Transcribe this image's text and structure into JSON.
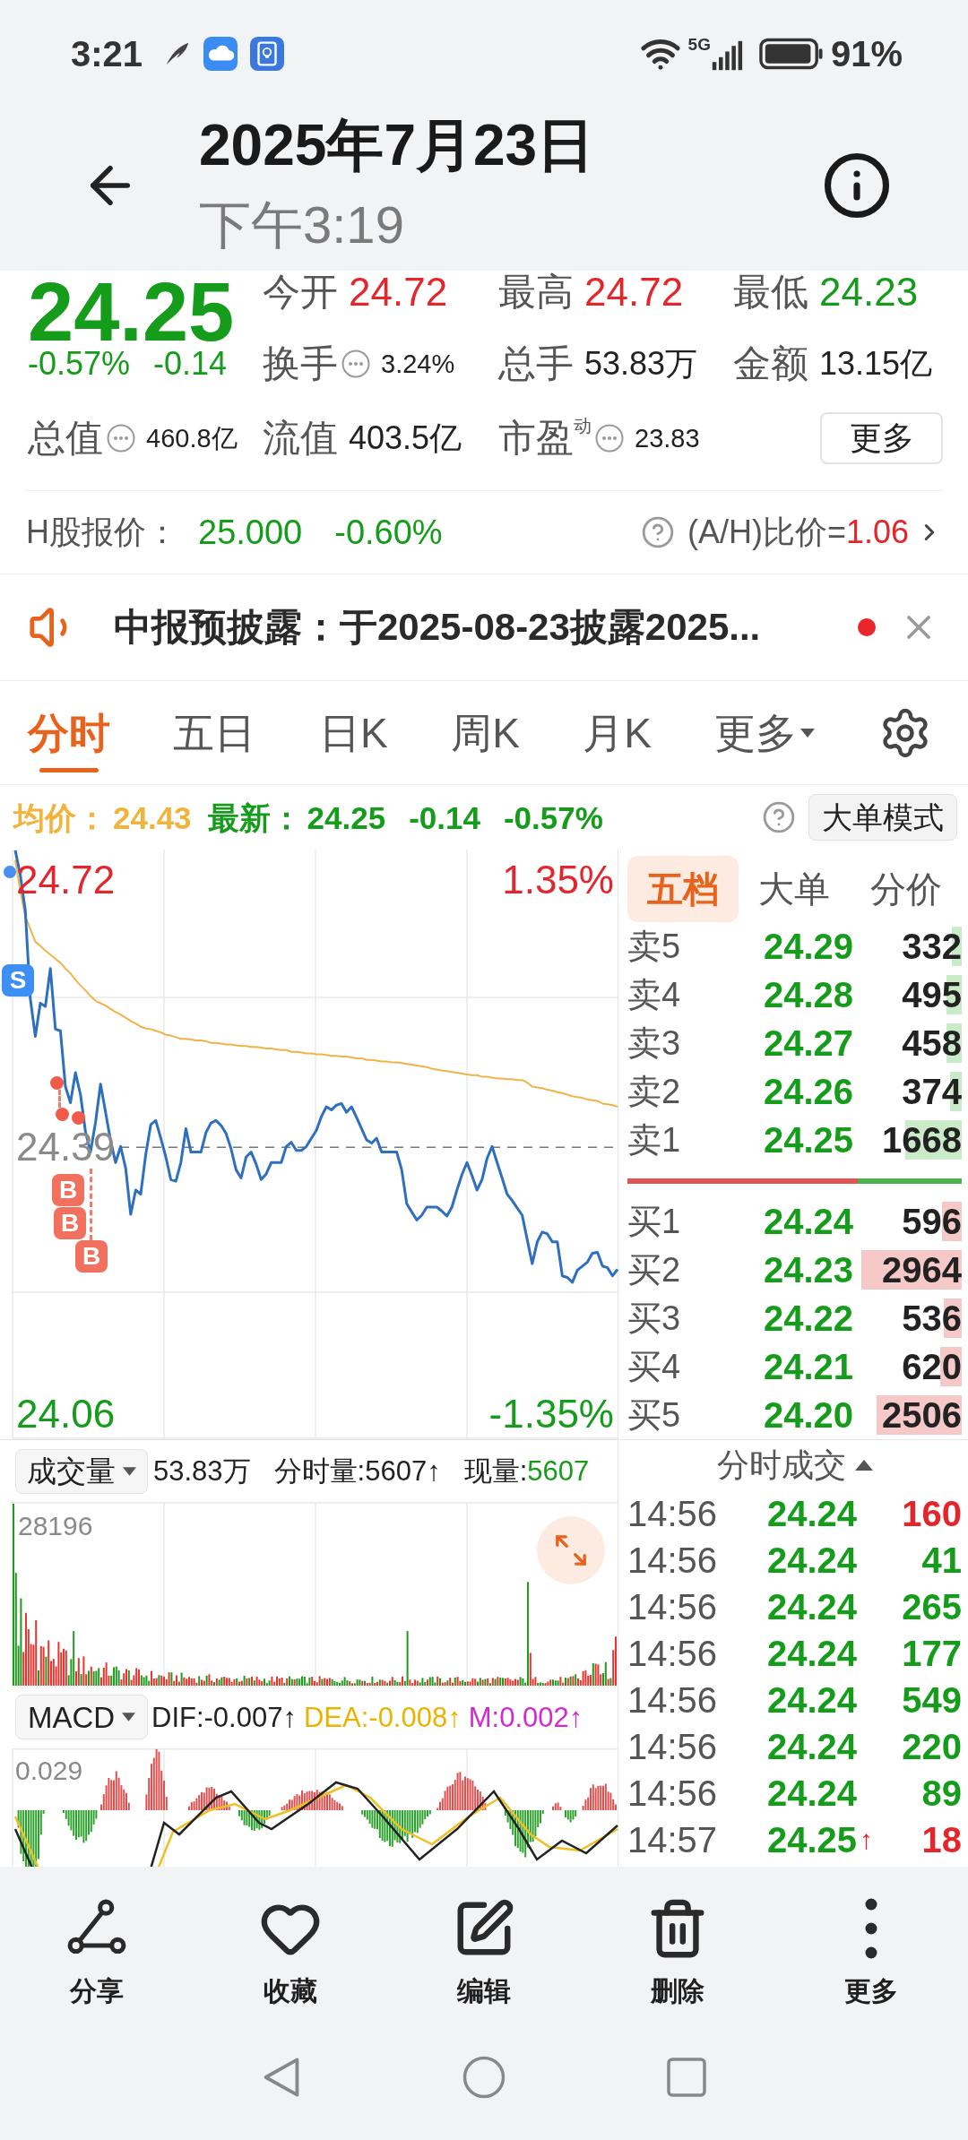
{
  "status_bar": {
    "time": "3:21",
    "network": "5G",
    "battery": "91%"
  },
  "header": {
    "title": "2025年7月23日",
    "subtitle": "下午3:19"
  },
  "quote": {
    "price": "24.25",
    "color": "#169c1b",
    "change_pct": "-0.57%",
    "change": "-0.14",
    "stats": [
      [
        {
          "label": "今开",
          "info": false,
          "value": "24.72",
          "color": "#e3262c"
        },
        {
          "label": "最高",
          "info": false,
          "value": "24.72",
          "color": "#e3262c"
        },
        {
          "label": "最低",
          "info": false,
          "value": "24.23",
          "color": "#169c1b"
        }
      ],
      [
        {
          "label": "换手",
          "info": true,
          "value": "3.24%",
          "color": "#222222"
        },
        {
          "label": "总手",
          "info": false,
          "value": "53.83万",
          "color": "#222222"
        },
        {
          "label": "金额",
          "info": false,
          "value": "13.15亿",
          "color": "#222222"
        }
      ],
      [
        {
          "label": "总值",
          "info": true,
          "value": "460.8亿",
          "color": "#222222"
        },
        {
          "label": "流值",
          "info": false,
          "value": "403.5亿",
          "color": "#222222"
        },
        {
          "label": "市盈",
          "superscript": "动",
          "info": true,
          "value": "23.83",
          "color": "#222222"
        }
      ]
    ],
    "more_button": "更多"
  },
  "h_share": {
    "label": "H股报价：",
    "price": "25.000",
    "change": "-0.60%",
    "color": "#169c1b",
    "ratio_label": "(A/H)比价=",
    "ratio": {
      "text": "1.06",
      "color": "#e3262c"
    }
  },
  "notice": {
    "text": "中报预披露：于2025-08-23披露2025...",
    "unread": true
  },
  "chart_tabs": [
    {
      "label": "分时",
      "selected": true,
      "dropdown": false
    },
    {
      "label": "五日",
      "selected": false,
      "dropdown": false
    },
    {
      "label": "日K",
      "selected": false,
      "dropdown": false
    },
    {
      "label": "周K",
      "selected": false,
      "dropdown": false
    },
    {
      "label": "月K",
      "selected": false,
      "dropdown": false
    },
    {
      "label": "更多",
      "selected": false,
      "dropdown": true
    }
  ],
  "summary": {
    "avg_label": "均价：",
    "avg": "24.43",
    "latest_label": "最新：",
    "latest": "24.25",
    "change": "-0.14",
    "change_pct": "-0.57%",
    "color": "#169c1b",
    "mode_button": "大单模式"
  },
  "price_chart": {
    "chart_data": {
      "type": "line",
      "categories": [
        null,
        null,
        null,
        null,
        null,
        null,
        null,
        null,
        null,
        null,
        null,
        null,
        null,
        null,
        null,
        null,
        null,
        null,
        null,
        null,
        null,
        null,
        null,
        null,
        null,
        null,
        null,
        null,
        null,
        null,
        null,
        null,
        null,
        null,
        null,
        null,
        null,
        null,
        null,
        null,
        null,
        null,
        null,
        null,
        null,
        null,
        null,
        null,
        null,
        null,
        null,
        null,
        null,
        null,
        null,
        null,
        null,
        null,
        null,
        null,
        null,
        null,
        null,
        null,
        null,
        null,
        null,
        null,
        null,
        null,
        null,
        null,
        null,
        null,
        null,
        null,
        null,
        null,
        null,
        null,
        null,
        null,
        null,
        null,
        null,
        null,
        null,
        null,
        null,
        null,
        null,
        null,
        null,
        null,
        null,
        null,
        null,
        null,
        null,
        null,
        null,
        null,
        null,
        null,
        null,
        null,
        null,
        null,
        null,
        null,
        null,
        null,
        null,
        null,
        null,
        null,
        null,
        null,
        null,
        null,
        null
      ],
      "series": [
        {
          "color": "#f0b44a",
          "values": [
            24.745,
            24.707,
            24.675,
            24.66,
            24.644,
            24.639,
            24.633,
            24.628,
            24.623,
            24.618,
            24.611,
            24.605,
            24.597,
            24.59,
            24.584,
            24.577,
            24.571,
            24.568,
            24.565,
            24.561,
            24.557,
            24.554,
            24.55,
            24.546,
            24.543,
            24.539,
            24.537,
            24.536,
            24.534,
            24.532,
            24.529,
            24.528,
            24.526,
            24.524,
            24.524,
            24.523,
            24.522,
            24.522,
            24.521,
            24.519,
            24.519,
            24.518,
            24.517,
            24.517,
            24.516,
            24.515,
            24.515,
            24.514,
            24.514,
            24.513,
            24.512,
            24.512,
            24.511,
            24.51,
            24.51,
            24.508,
            24.508,
            24.507,
            24.506,
            24.506,
            24.505,
            24.505,
            24.504,
            24.503,
            24.503,
            24.502,
            24.502,
            24.501,
            24.5,
            24.5,
            24.498,
            24.498,
            24.497,
            24.496,
            24.496,
            24.495,
            24.495,
            24.494,
            24.493,
            24.492,
            24.491,
            24.49,
            24.489,
            24.487,
            24.486,
            24.485,
            24.484,
            24.483,
            24.482,
            24.481,
            24.48,
            24.479,
            24.479,
            24.477,
            24.477,
            24.476,
            24.475,
            24.475,
            24.474,
            24.474,
            24.473,
            24.473,
            24.47,
            24.465,
            24.464,
            24.463,
            24.461,
            24.46,
            24.458,
            24.457,
            24.455,
            24.453,
            24.452,
            24.451,
            24.449,
            24.448,
            24.447,
            24.444,
            24.443,
            24.442,
            24.44
          ]
        },
        {
          "color": "#2f6fbf",
          "values": [
            24.757,
            24.727,
            24.683,
            24.574,
            24.527,
            24.568,
            24.564,
            24.611,
            24.536,
            24.534,
            24.465,
            24.445,
            24.482,
            24.455,
            24.409,
            24.384,
            24.421,
            24.468,
            24.433,
            24.398,
            24.371,
            24.391,
            24.364,
            24.307,
            24.337,
            24.332,
            24.381,
            24.418,
            24.423,
            24.401,
            24.378,
            24.35,
            24.348,
            24.371,
            24.413,
            24.384,
            24.384,
            24.384,
            24.408,
            24.42,
            24.423,
            24.417,
            24.407,
            24.388,
            24.362,
            24.352,
            24.378,
            24.384,
            24.369,
            24.35,
            24.357,
            24.371,
            24.371,
            24.371,
            24.391,
            24.396,
            24.386,
            24.386,
            24.391,
            24.401,
            24.411,
            24.428,
            24.44,
            24.436,
            24.442,
            24.444,
            24.433,
            24.44,
            24.427,
            24.413,
            24.399,
            24.395,
            24.401,
            24.384,
            24.384,
            24.384,
            24.384,
            24.362,
            24.32,
            24.31,
            24.3,
            24.306,
            24.316,
            24.316,
            24.316,
            24.311,
            24.305,
            24.316,
            24.337,
            24.356,
            24.371,
            24.355,
            24.337,
            24.35,
            24.376,
            24.391,
            24.371,
            24.352,
            24.332,
            24.324,
            24.315,
            24.306,
            24.276,
            24.246,
            24.273,
            24.285,
            24.283,
            24.273,
            24.273,
            24.231,
            24.229,
            24.223,
            24.238,
            24.243,
            24.248,
            24.259,
            24.26,
            24.243,
            24.241,
            24.231,
            24.239
          ]
        }
      ],
      "ylim": [
        24.029,
        24.758
      ],
      "yticks": [
        {
          "value": 24.06,
          "label": "24.06"
        },
        {
          "value": 24.39,
          "label": "24.39"
        },
        {
          "value": 24.72,
          "label": "24.72"
        }
      ],
      "ref_lines": [
        {
          "axis": "y",
          "value": 24.39
        }
      ]
    },
    "high_pct": "1.35%",
    "low_pct": "-1.35%",
    "markers": [
      {
        "kind": "sell",
        "label": "S"
      },
      {
        "kind": "buy",
        "label": "B"
      },
      {
        "kind": "buy",
        "label": "B"
      },
      {
        "kind": "buy",
        "label": "B"
      }
    ]
  },
  "order_book": {
    "tabs": [
      {
        "label": "五档",
        "selected": true
      },
      {
        "label": "大单",
        "selected": false
      },
      {
        "label": "分价",
        "selected": false
      }
    ],
    "asks": [
      {
        "label": "卖5",
        "price": "24.29",
        "volume": "332",
        "color": "#169c1b",
        "level": 0.1
      },
      {
        "label": "卖4",
        "price": "24.28",
        "volume": "495",
        "color": "#169c1b",
        "level": 0.15
      },
      {
        "label": "卖3",
        "price": "24.27",
        "volume": "458",
        "color": "#169c1b",
        "level": 0.15
      },
      {
        "label": "卖2",
        "price": "24.26",
        "volume": "374",
        "color": "#169c1b",
        "level": 0.12
      },
      {
        "label": "卖1",
        "price": "24.25",
        "volume": "1668",
        "color": "#169c1b",
        "level": 0.56
      }
    ],
    "balance": {
      "level": 0.69
    },
    "bids": [
      {
        "label": "买1",
        "price": "24.24",
        "volume": "596",
        "color": "#169c1b",
        "level": 0.2
      },
      {
        "label": "买2",
        "price": "24.23",
        "volume": "2964",
        "color": "#169c1b",
        "level": 1
      },
      {
        "label": "买3",
        "price": "24.22",
        "volume": "536",
        "color": "#169c1b",
        "level": 0.18
      },
      {
        "label": "买4",
        "price": "24.21",
        "volume": "620",
        "color": "#169c1b",
        "level": 0.21
      },
      {
        "label": "买5",
        "price": "24.20",
        "volume": "2506",
        "color": "#169c1b",
        "level": 0.85
      }
    ]
  },
  "volume": {
    "selector": "成交量",
    "total": "53.83万",
    "minute": "分时量:5607↑",
    "current_label": "现量:",
    "current": {
      "text": "5607",
      "color": "#169c1b"
    },
    "max": "28196"
  },
  "macd": {
    "selector": "MACD",
    "dif": "DIF:-0.007↑",
    "dea": "DEA:-0.008↑",
    "m": "M:0.002↑",
    "max": "0.029"
  },
  "trades": {
    "title": "分时成交",
    "rows": [
      {
        "time": "14:56",
        "price": {
          "text": "24.24",
          "color": "#169c1b"
        },
        "volume": {
          "text": "160",
          "color": "#e3262c"
        }
      },
      {
        "time": "14:56",
        "price": {
          "text": "24.24",
          "color": "#169c1b"
        },
        "volume": {
          "text": "41",
          "color": "#169c1b"
        }
      },
      {
        "time": "14:56",
        "price": {
          "text": "24.24",
          "color": "#169c1b"
        },
        "volume": {
          "text": "265",
          "color": "#169c1b"
        }
      },
      {
        "time": "14:56",
        "price": {
          "text": "24.24",
          "color": "#169c1b"
        },
        "volume": {
          "text": "177",
          "color": "#169c1b"
        }
      },
      {
        "time": "14:56",
        "price": {
          "text": "24.24",
          "color": "#169c1b"
        },
        "volume": {
          "text": "549",
          "color": "#169c1b"
        }
      },
      {
        "time": "14:56",
        "price": {
          "text": "24.24",
          "color": "#169c1b"
        },
        "volume": {
          "text": "220",
          "color": "#169c1b"
        }
      },
      {
        "time": "14:56",
        "price": {
          "text": "24.24",
          "color": "#169c1b"
        },
        "volume": {
          "text": "89",
          "color": "#169c1b"
        }
      },
      {
        "time": "14:57",
        "price": {
          "text": "24.25",
          "color": "#169c1b"
        },
        "arrow": "↑",
        "volume": {
          "text": "18",
          "color": "#e3262c"
        }
      }
    ]
  },
  "actions": [
    {
      "kind": "share",
      "label": "分享"
    },
    {
      "kind": "favorite",
      "label": "收藏"
    },
    {
      "kind": "edit",
      "label": "编辑"
    },
    {
      "kind": "delete",
      "label": "删除"
    },
    {
      "kind": "more",
      "label": "更多"
    }
  ]
}
